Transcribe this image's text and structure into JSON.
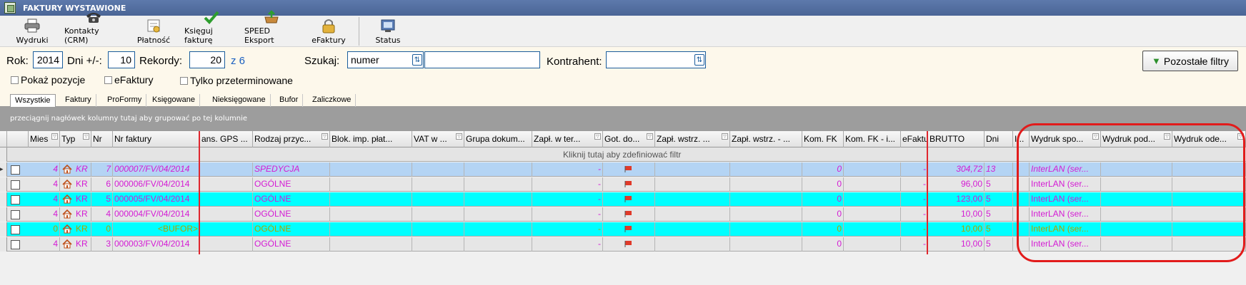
{
  "window": {
    "title": "FAKTURY WYSTAWIONE"
  },
  "toolbar": {
    "items": [
      {
        "label": "Wydruki",
        "icon": "printer-icon"
      },
      {
        "label": "Kontakty (CRM)",
        "icon": "telephone-icon"
      },
      {
        "label": "Płatność",
        "icon": "payment-icon"
      },
      {
        "label": "Księguj fakturę",
        "icon": "checkmark-icon"
      },
      {
        "label": "SPEED Eksport",
        "icon": "export-icon"
      },
      {
        "label": "eFaktury",
        "icon": "lock-icon"
      },
      {
        "label": "Status",
        "icon": "status-icon"
      }
    ]
  },
  "filters": {
    "rok_label": "Rok:",
    "rok_value": "2014",
    "dni_label": "Dni +/-:",
    "dni_value": "10",
    "rekordy_label": "Rekordy:",
    "rekordy_value": "20",
    "rekordy_total": "z 6",
    "szukaj_label": "Szukaj:",
    "szukaj_field": "numer",
    "szukaj_value": "",
    "kontrahent_label": "Kontrahent:",
    "kontrahent_value": "",
    "pozostale_label": "Pozostałe filtry",
    "checks": [
      "Pokaż pozycje",
      "eFaktury",
      "Tylko przeterminowane"
    ]
  },
  "tabs": [
    "Wszystkie",
    "Faktury",
    "ProFormy",
    "Księgowane",
    "Nieksięgowane",
    "Bufor",
    "Zaliczkowe"
  ],
  "groupbar": "przeciągnij nagłówek kolumny tutaj aby grupować po tej kolumnie",
  "filter_row_text": "Kliknij tutaj aby zdefiniować filtr",
  "columns": [
    "Mies",
    "Typ",
    "Nr",
    "Nr faktury",
    "ans. GPS ...",
    "Rodzaj przyc...",
    "Blok. imp. płat...",
    "VAT w ...",
    "Grupa dokum...",
    "Zapł. w ter...",
    "Got. do...",
    "Zapł. wstrz. ...",
    "Zapł. wstrz. - ...",
    "Kom. FK",
    "Kom. FK - i...",
    "eFaktu",
    "BRUTTO",
    "Dni",
    "I...",
    "Wydruk spo...",
    "Wydruk pod...",
    "Wydruk ode..."
  ],
  "rows": [
    {
      "mies": "4",
      "typ": "KR",
      "nr": "7",
      "nr_faktury": "000007/FV/04/2014",
      "rodzaj": "SPEDYCJA",
      "zapl": "-",
      "kom": "0",
      "efakt": "-",
      "brutto": "304,72",
      "dni": "13",
      "wydruk": "InterLAN (ser..."
    },
    {
      "mies": "4",
      "typ": "KR",
      "nr": "6",
      "nr_faktury": "000006/FV/04/2014",
      "rodzaj": "OGÓLNE",
      "zapl": "-",
      "kom": "0",
      "efakt": "-",
      "brutto": "96,00",
      "dni": "5",
      "wydruk": "InterLAN (ser..."
    },
    {
      "mies": "4",
      "typ": "KR",
      "nr": "5",
      "nr_faktury": "000005/FV/04/2014",
      "rodzaj": "OGÓLNE",
      "zapl": "-",
      "kom": "0",
      "efakt": "-",
      "brutto": "123,00",
      "dni": "5",
      "wydruk": "InterLAN (ser..."
    },
    {
      "mies": "4",
      "typ": "KR",
      "nr": "4",
      "nr_faktury": "000004/FV/04/2014",
      "rodzaj": "OGÓLNE",
      "zapl": "-",
      "kom": "0",
      "efakt": "-",
      "brutto": "10,00",
      "dni": "5",
      "wydruk": "InterLAN (ser..."
    },
    {
      "mies": "0",
      "typ": "KR",
      "nr": "0",
      "nr_faktury": "<BUFOR>",
      "rodzaj": "OGÓLNE",
      "zapl": "-",
      "kom": "0",
      "efakt": "-",
      "brutto": "10,00",
      "dni": "5",
      "wydruk": "InterLAN (ser..."
    },
    {
      "mies": "4",
      "typ": "KR",
      "nr": "3",
      "nr_faktury": "000003/FV/04/2014",
      "rodzaj": "OGÓLNE",
      "zapl": "-",
      "kom": "0",
      "efakt": "-",
      "brutto": "10,00",
      "dni": "5",
      "wydruk": "InterLAN (ser..."
    }
  ],
  "colors": {
    "row_selected": "#b4d4f4",
    "row_cyan": "#00ffff",
    "row_gray": "#e6e6e6",
    "text_magenta": "#d41bd4",
    "text_olive": "#b0a000",
    "highlight": "#e21b1b"
  }
}
